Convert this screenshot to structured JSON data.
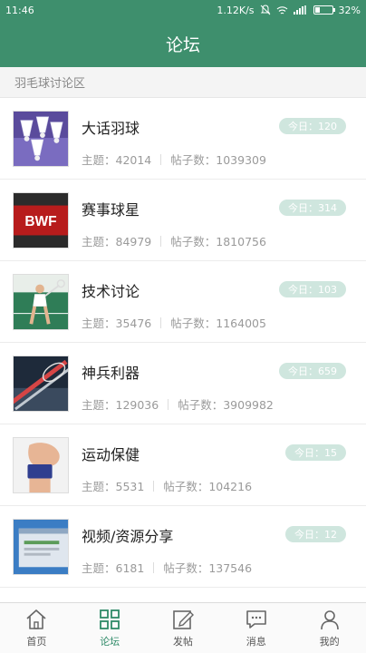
{
  "status_bar": {
    "time": "11:46",
    "net_speed": "1.12K/s",
    "battery": "32%",
    "battery_level": 0.32
  },
  "header": {
    "title": "论坛"
  },
  "section": {
    "title": "羽毛球讨论区"
  },
  "forums": [
    {
      "name": "大话羽球",
      "today": "今日：120",
      "topics": "主题：42014",
      "posts": "帖子数：1039309",
      "image": "shuttlecocks"
    },
    {
      "name": "赛事球星",
      "today": "今日：314",
      "topics": "主题：84979",
      "posts": "帖子数：1810756",
      "image": "bwf-logo",
      "logo_text": "BWF"
    },
    {
      "name": "技术讨论",
      "today": "今日：103",
      "topics": "主题：35476",
      "posts": "帖子数：1164005",
      "image": "player"
    },
    {
      "name": "神兵利器",
      "today": "今日：659",
      "topics": "主题：129036",
      "posts": "帖子数：3909982",
      "image": "racket"
    },
    {
      "name": "运动保健",
      "today": "今日：15",
      "topics": "主题：5531",
      "posts": "帖子数：104216",
      "image": "wristband"
    },
    {
      "name": "视频/资源分享",
      "today": "今日：12",
      "topics": "主题：6181",
      "posts": "帖子数：137546",
      "image": "screen"
    }
  ],
  "tabs": [
    {
      "label": "首页",
      "icon": "home-icon"
    },
    {
      "label": "论坛",
      "icon": "grid-icon",
      "active": true
    },
    {
      "label": "发帖",
      "icon": "edit-icon"
    },
    {
      "label": "消息",
      "icon": "message-icon"
    },
    {
      "label": "我的",
      "icon": "user-icon"
    }
  ],
  "colors": {
    "primary": "#3e8f6d",
    "badge": "#cfe6de",
    "tab_active": "#2f8a68"
  }
}
